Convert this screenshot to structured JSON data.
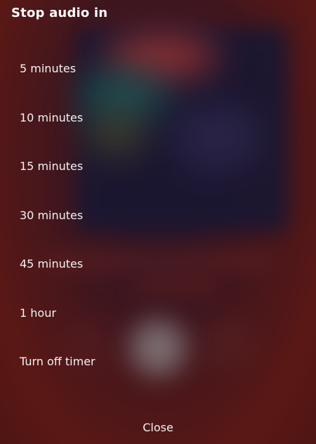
{
  "sheet": {
    "title": "Stop audio in",
    "options": [
      {
        "label": "5 minutes"
      },
      {
        "label": "10 minutes"
      },
      {
        "label": "15 minutes"
      },
      {
        "label": "30 minutes"
      },
      {
        "label": "45 minutes"
      },
      {
        "label": "1 hour"
      },
      {
        "label": "Turn off timer"
      }
    ],
    "close_label": "Close"
  },
  "colors": {
    "text": "#ffffff",
    "background": "#5a1a17"
  }
}
